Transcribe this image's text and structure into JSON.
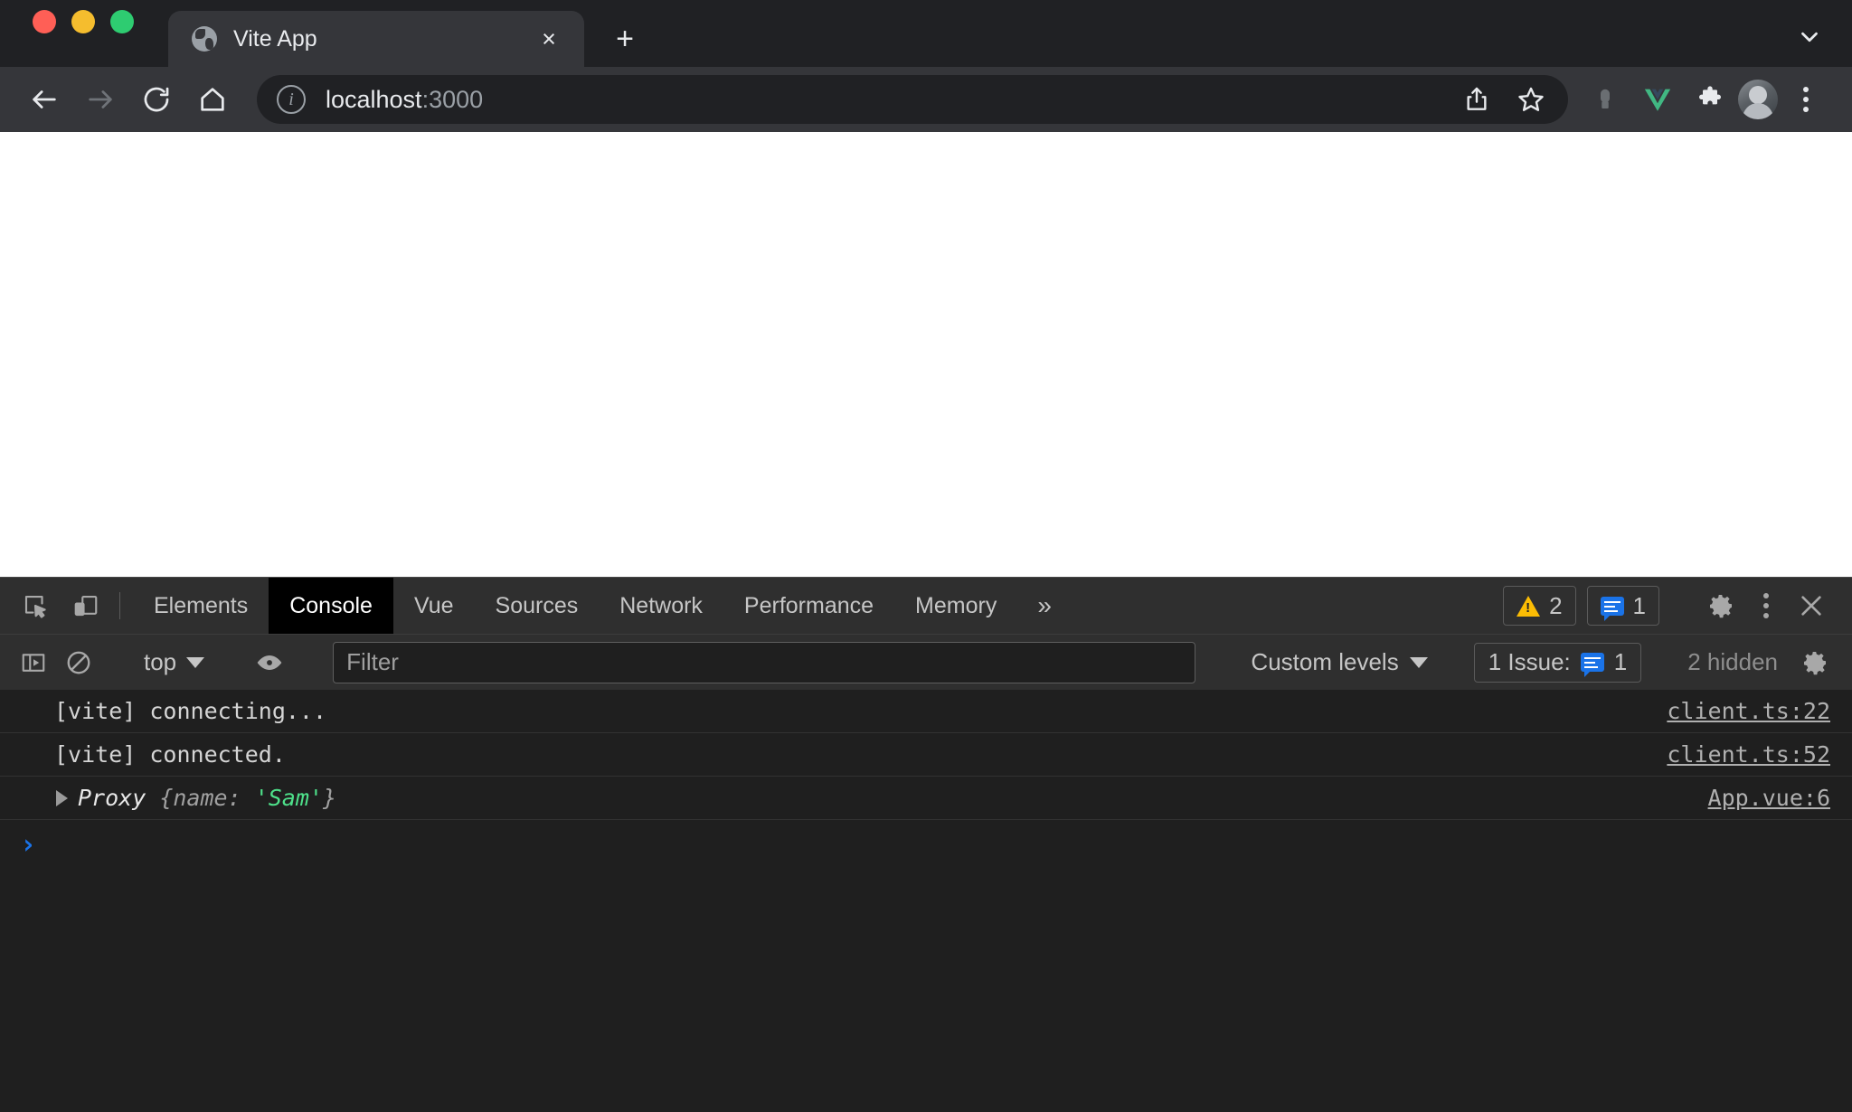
{
  "window": {
    "traffic_lights": [
      {
        "name": "close",
        "color": "#ff5f56"
      },
      {
        "name": "minimize",
        "color": "#f5bd2e"
      },
      {
        "name": "zoom",
        "color": "#2ecc71"
      }
    ]
  },
  "tabstrip": {
    "tabs": [
      {
        "title": "Vite App",
        "favicon": "globe-icon",
        "close_label": "×",
        "active": true
      }
    ],
    "new_tab_label": "+",
    "tab_list_icon": "chevron-down-icon"
  },
  "toolbar": {
    "back_icon": "back-arrow-icon",
    "forward_icon": "forward-arrow-icon",
    "reload_icon": "reload-icon",
    "home_icon": "home-icon",
    "omnibox": {
      "info_icon": "info-circle-icon",
      "url_host": "localhost",
      "url_port": ":3000",
      "share_icon": "share-icon",
      "bookmark_icon": "star-icon"
    },
    "extensions": [
      {
        "name": "extension-muted-icon"
      },
      {
        "name": "vue-devtools-icon",
        "color": "#41b883"
      },
      {
        "name": "puzzle-extensions-icon"
      }
    ],
    "avatar_name": "profile-avatar",
    "menu_icon": "kebab-menu-icon"
  },
  "devtools": {
    "left_icons": [
      {
        "name": "inspect-element-icon"
      },
      {
        "name": "device-toolbar-icon"
      }
    ],
    "tabs": [
      {
        "label": "Elements",
        "active": false
      },
      {
        "label": "Console",
        "active": true
      },
      {
        "label": "Vue",
        "active": false
      },
      {
        "label": "Sources",
        "active": false
      },
      {
        "label": "Network",
        "active": false
      },
      {
        "label": "Performance",
        "active": false
      },
      {
        "label": "Memory",
        "active": false
      }
    ],
    "more_tabs_label": "»",
    "warning_badge": {
      "icon": "warning-triangle-icon",
      "count": "2",
      "color": "#fbbc04"
    },
    "message_badge": {
      "icon": "message-bubble-icon",
      "count": "1",
      "color": "#1a73e8"
    },
    "settings_icon": "gear-icon",
    "more_options_icon": "kebab-menu-icon",
    "close_icon": "close-icon",
    "filterbar": {
      "sidebar_icon": "console-sidebar-icon",
      "clear_icon": "clear-console-icon",
      "context": "top",
      "eye_icon": "live-expression-eye-icon",
      "filter_placeholder": "Filter",
      "filter_value": "",
      "levels_label": "Custom levels",
      "issues_label": "1 Issue:",
      "issues_count": "1",
      "hidden_label": "2 hidden",
      "settings_icon": "gear-icon"
    },
    "console": {
      "rows": [
        {
          "type": "log",
          "text": "[vite] connecting...",
          "source": "client.ts:22",
          "expandable": false
        },
        {
          "type": "log",
          "text": "[vite] connected.",
          "source": "client.ts:52",
          "expandable": false
        },
        {
          "type": "object",
          "object_name": "Proxy",
          "open_brace": " {",
          "key": "name:",
          "value": "'Sam'",
          "close_brace": "}",
          "source": "App.vue:6",
          "expandable": true
        }
      ],
      "prompt_caret": "›"
    }
  }
}
